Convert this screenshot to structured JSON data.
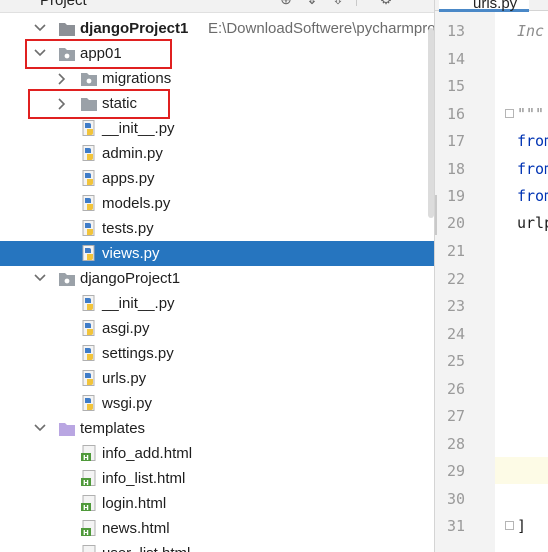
{
  "panel": {
    "title": "Project"
  },
  "tree": [
    {
      "label": "djangoProject1",
      "path": "E:\\DownloadSoftwere\\pycharmpro",
      "kind": "project-folder"
    },
    {
      "label": "app01",
      "kind": "package"
    },
    {
      "label": "migrations",
      "kind": "package"
    },
    {
      "label": "static",
      "kind": "folder"
    },
    {
      "label": "__init__.py",
      "kind": "python-file"
    },
    {
      "label": "admin.py",
      "kind": "python-file"
    },
    {
      "label": "apps.py",
      "kind": "python-file"
    },
    {
      "label": "models.py",
      "kind": "python-file"
    },
    {
      "label": "tests.py",
      "kind": "python-file"
    },
    {
      "label": "views.py",
      "kind": "python-file",
      "selected": true
    },
    {
      "label": "djangoProject1",
      "kind": "package"
    },
    {
      "label": "__init__.py",
      "kind": "python-file"
    },
    {
      "label": "asgi.py",
      "kind": "python-file"
    },
    {
      "label": "settings.py",
      "kind": "python-file"
    },
    {
      "label": "urls.py",
      "kind": "python-file"
    },
    {
      "label": "wsgi.py",
      "kind": "python-file"
    },
    {
      "label": "templates",
      "kind": "templates-folder"
    },
    {
      "label": "info_add.html",
      "kind": "html-file"
    },
    {
      "label": "info_list.html",
      "kind": "html-file"
    },
    {
      "label": "login.html",
      "kind": "html-file"
    },
    {
      "label": "news.html",
      "kind": "html-file"
    },
    {
      "label": "user_list.html",
      "kind": "html-file"
    }
  ],
  "editor": {
    "tab_label": "urls.py",
    "line_numbers": [
      "13",
      "14",
      "15",
      "16",
      "17",
      "18",
      "19",
      "20",
      "21",
      "22",
      "23",
      "24",
      "25",
      "26",
      "27",
      "28",
      "29",
      "30",
      "31"
    ],
    "code_lines": [
      "Inc",
      "",
      "",
      "\"\"\"",
      "from",
      "from",
      "from",
      "urlp",
      "",
      "",
      "",
      "",
      "",
      "",
      "",
      "",
      "",
      "",
      "]"
    ]
  },
  "colors": {
    "selection": "#2675bf",
    "highlight_box": "#e02020",
    "keyword": "#0033b3",
    "comment": "#8c8c8c"
  }
}
